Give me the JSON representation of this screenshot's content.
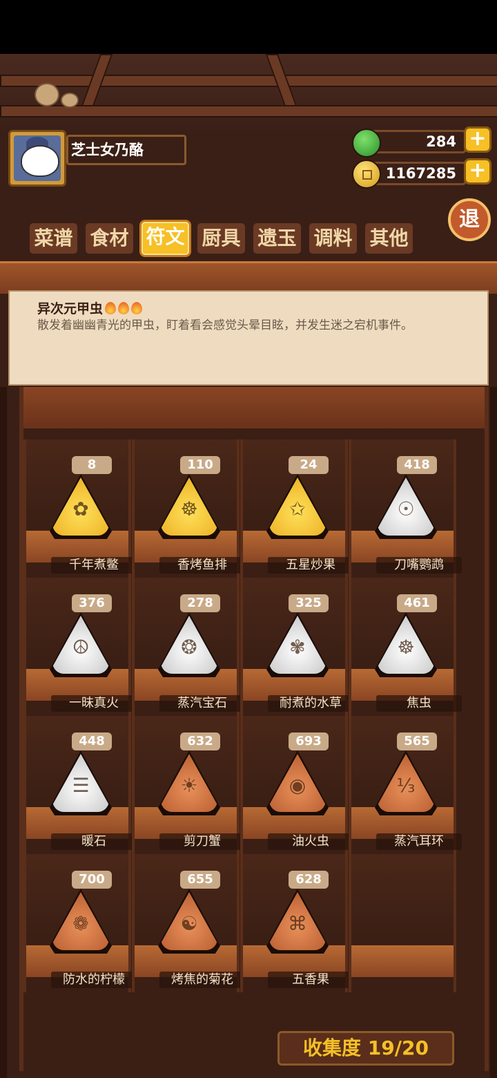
{
  "player": {
    "name": "芝士女乃酪"
  },
  "currency": {
    "jade": "284",
    "coins": "1167285"
  },
  "exit_label": "退",
  "tabs": [
    "菜谱",
    "食材",
    "符文",
    "厨具",
    "遗玉",
    "调料",
    "其他"
  ],
  "active_tab": 2,
  "selected": {
    "title": "异次元甲虫",
    "flames": 3,
    "description": "散发着幽幽青光的甲虫，盯着看会感觉头晕目眩，并发生迷之宕机事件。"
  },
  "runes": [
    {
      "name": "千年煮鳖",
      "count": "8",
      "tier": "gold"
    },
    {
      "name": "香烤鱼排",
      "count": "110",
      "tier": "gold"
    },
    {
      "name": "五星炒果",
      "count": "24",
      "tier": "gold"
    },
    {
      "name": "刀嘴鹦鹉",
      "count": "418",
      "tier": "silver"
    },
    {
      "name": "一昧真火",
      "count": "376",
      "tier": "silver"
    },
    {
      "name": "蒸汽宝石",
      "count": "278",
      "tier": "silver"
    },
    {
      "name": "耐煮的水草",
      "count": "325",
      "tier": "silver"
    },
    {
      "name": "焦虫",
      "count": "461",
      "tier": "silver"
    },
    {
      "name": "暖石",
      "count": "448",
      "tier": "silver"
    },
    {
      "name": "剪刀蟹",
      "count": "632",
      "tier": "copper"
    },
    {
      "name": "油火虫",
      "count": "693",
      "tier": "copper"
    },
    {
      "name": "蒸汽耳环",
      "count": "565",
      "tier": "copper"
    },
    {
      "name": "防水的柠檬",
      "count": "700",
      "tier": "copper"
    },
    {
      "name": "烤焦的菊花",
      "count": "655",
      "tier": "copper"
    },
    {
      "name": "五香果",
      "count": "628",
      "tier": "copper"
    }
  ],
  "collection_progress": "收集度 19/20"
}
